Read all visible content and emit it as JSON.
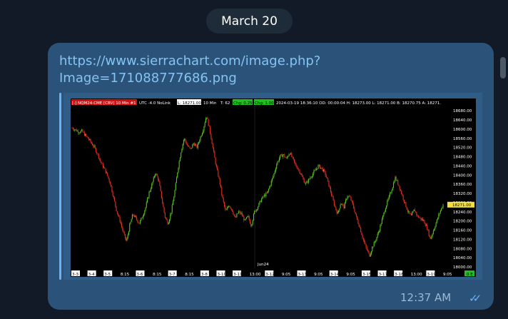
{
  "date_label": "March 20",
  "message": {
    "link_line1": "https://www.sierrachart.com/image.php?",
    "link_line2": "Image=171088777686.png",
    "time": "12:37 AM",
    "status_icon": "double-check-icon"
  },
  "chart_header": {
    "symbol": "[-] NQM24-CME [CBV] 10 Min  #1",
    "tz": "UTC -4.0 NoLink",
    "last": "L: 18271.00",
    "interval": "10 Min",
    "t": "T: 62",
    "chg1": "Chg: 0.25",
    "chg2": "Chg: 1.00",
    "datetime": "2024-03-19 18:36:10  OD: 00:00:04  H: 18273.00  L: 18271.00  B: 18270.75  A: 18271.",
    "price_tag": "18271.00"
  },
  "chart_data": {
    "type": "candlestick",
    "y_ticks": [
      18680,
      18640,
      18600,
      18560,
      18520,
      18480,
      18440,
      18400,
      18360,
      18320,
      18280,
      18240,
      18200,
      18160,
      18120,
      18080,
      18040,
      18000
    ],
    "ylim": [
      18000,
      18690
    ],
    "close_path": [
      18605,
      18598,
      18588,
      18592,
      18575,
      18560,
      18540,
      18520,
      18490,
      18455,
      18430,
      18400,
      18360,
      18300,
      18240,
      18200,
      18150,
      18110,
      18180,
      18230,
      18210,
      18190,
      18220,
      18260,
      18320,
      18360,
      18410,
      18380,
      18300,
      18220,
      18190,
      18240,
      18320,
      18420,
      18500,
      18560,
      18530,
      18510,
      18540,
      18520,
      18560,
      18600,
      18660,
      18600,
      18520,
      18440,
      18380,
      18300,
      18240,
      18270,
      18250,
      18210,
      18240,
      18230,
      18200,
      18220,
      18180,
      18240,
      18260,
      18290,
      18310,
      18320,
      18360,
      18400,
      18450,
      18480,
      18490,
      18470,
      18500,
      18470,
      18440,
      18420,
      18390,
      18360,
      18380,
      18400,
      18420,
      18440,
      18430,
      18410,
      18370,
      18320,
      18270,
      18230,
      18280,
      18260,
      18310,
      18300,
      18260,
      18210,
      18170,
      18120,
      18080,
      18050,
      18090,
      18120,
      18160,
      18210,
      18260,
      18300,
      18340,
      18390,
      18360,
      18320,
      18280,
      18240,
      18220,
      18250,
      18220,
      18210,
      18200,
      18170,
      18120,
      18160,
      18200,
      18240,
      18271
    ],
    "x_labels": [
      "3-3",
      "3-4",
      "3-5",
      "8:15",
      "3-6",
      "8:15",
      "3-7",
      "8:15",
      "3-8",
      "3-10",
      "3-11",
      "13:00",
      "3-12",
      "9:05",
      "3-13",
      "9:05",
      "3-14",
      "9:05",
      "3-15",
      "3-17",
      "3-18",
      "13:00",
      "3-19",
      "9:05"
    ],
    "annotation": "Jun24",
    "corner_label": "0 E"
  }
}
